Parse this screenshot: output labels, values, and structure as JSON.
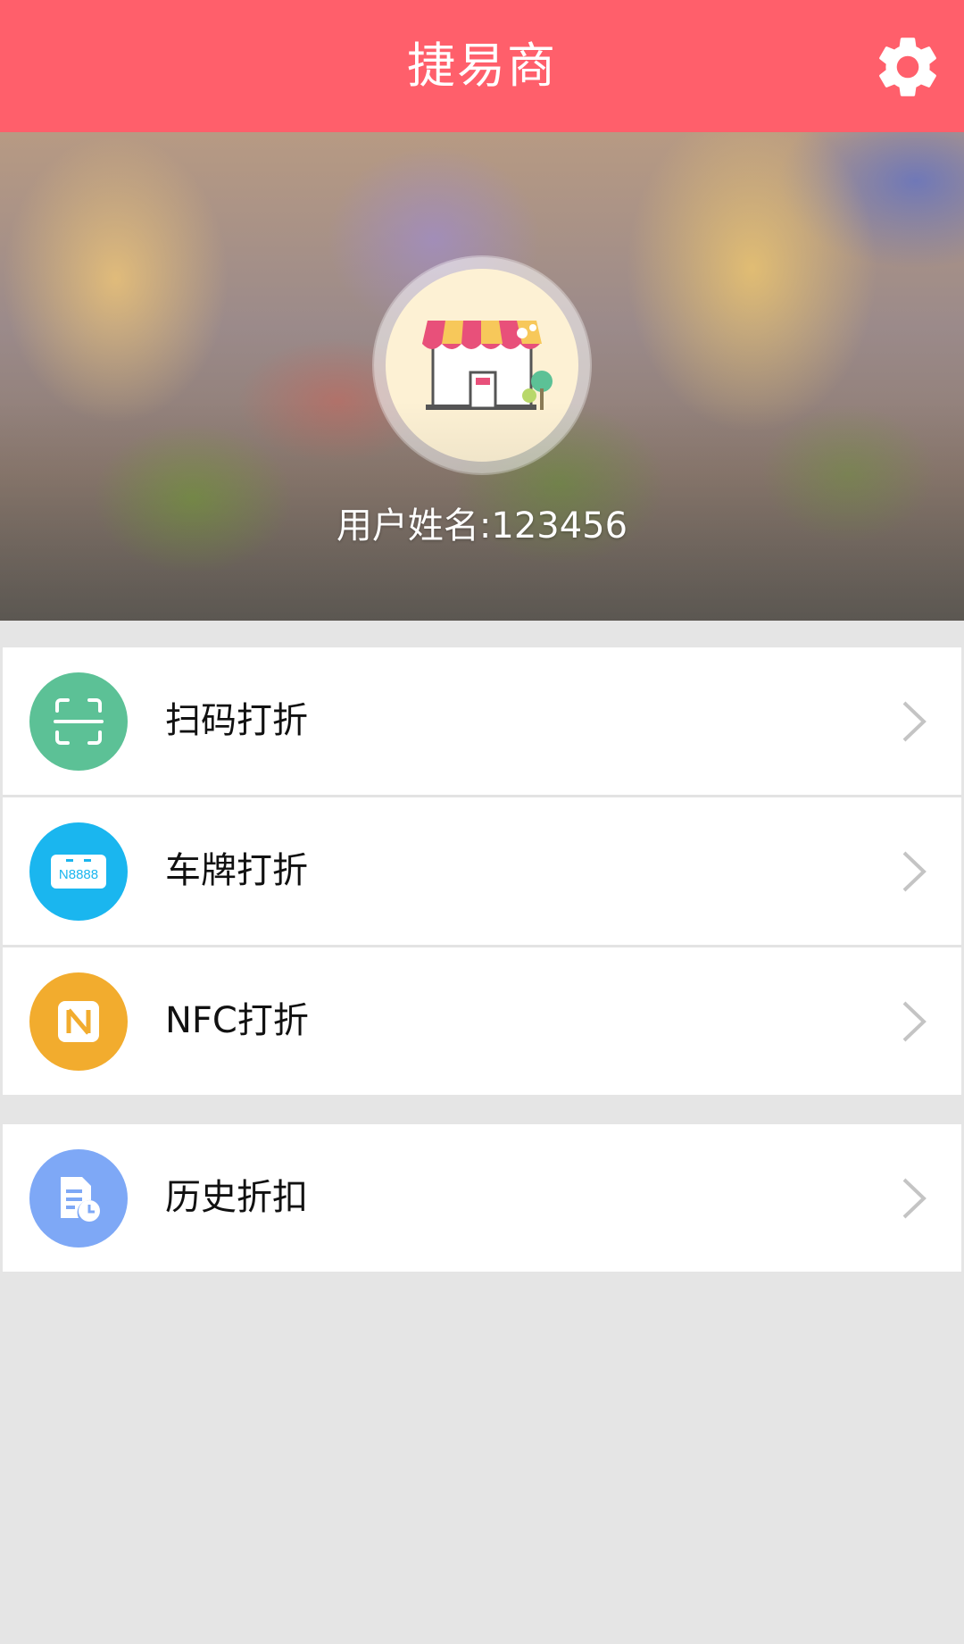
{
  "header": {
    "title": "捷易商",
    "settings_icon": "gear-icon"
  },
  "profile": {
    "avatar_icon": "shop-storefront-icon",
    "username_text": "用户姓名:123456"
  },
  "menu_group_1": [
    {
      "label": "扫码打折",
      "icon": "scan-icon",
      "color": "#5cc196"
    },
    {
      "label": "车牌打折",
      "icon": "license-plate-icon",
      "color": "#1ab6ef",
      "plate_text": "N8888"
    },
    {
      "label": "NFC打折",
      "icon": "nfc-icon",
      "color": "#f2ac2e"
    }
  ],
  "menu_group_2": [
    {
      "label": "历史折扣",
      "icon": "history-document-icon",
      "color": "#7ea8f6"
    }
  ],
  "colors": {
    "header": "#ff5f6b",
    "background": "#e5e5e5"
  }
}
